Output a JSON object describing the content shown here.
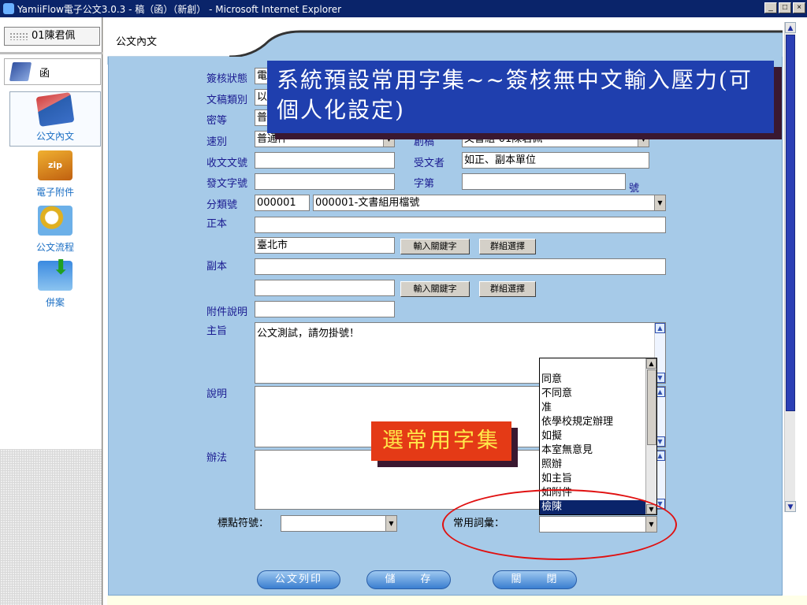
{
  "window": {
    "title": "YamiiFlow電子公文3.0.3 - 稿（函）（新創） - Microsoft Internet Explorer",
    "buttons": [
      "_",
      "□",
      "×"
    ]
  },
  "sidebar": {
    "user": "01陳君佩",
    "header": "函",
    "items": [
      {
        "label": "公文內文",
        "icon": "document-stack-icon",
        "active": true
      },
      {
        "label": "電子附件",
        "icon": "zip-icon",
        "active": false
      },
      {
        "label": "公文流程",
        "icon": "flow-icon",
        "active": false
      },
      {
        "label": "併案",
        "icon": "merge-icon",
        "active": false
      }
    ]
  },
  "main": {
    "tab_title": "公文內文"
  },
  "form": {
    "labels": {
      "sign_status": "簽核狀態",
      "draft_type": "文稿類別",
      "secrecy": "密等",
      "speed": "速別",
      "sender_no": "收文文號",
      "doc_no": "發文字號",
      "category_no": "分類號",
      "main_recipient": "正本",
      "cc": "副本",
      "attachment_desc": "附件說明",
      "subject": "主旨",
      "description": "說明",
      "method": "辦法",
      "unit": "創稿",
      "recipient": "受文者",
      "word_no": "字第",
      "hao": "號",
      "punctuation": "標點符號：",
      "common_phrases": "常用詞彙："
    },
    "values": {
      "sign_status": "電",
      "draft_type": "以",
      "secrecy": "普",
      "speed": "普通件",
      "unit": "文書組-01陳君佩",
      "sender_no": "",
      "doc_no": "",
      "recipient": "如正、副本單位",
      "word_no": "",
      "category_code": "000001",
      "category_name": "000001-文書組用檔號",
      "main_recipient": "",
      "main_recipient_keyword": "臺北市",
      "cc": "",
      "cc_keyword": "",
      "attachment_desc": "",
      "subject": "公文測試，請勿掛號！",
      "description": "",
      "method": "",
      "punctuation": "",
      "common_phrases": ""
    },
    "buttons": {
      "keyword_input": "輸入關鍵字",
      "group_select": "群組選擇"
    },
    "phrase_options": [
      "同意",
      "不同意",
      "准",
      "依學校規定辦理",
      "如擬",
      "本室無意見",
      "照辦",
      "如主旨",
      "如附件",
      "檢陳"
    ],
    "phrase_selected": "檢陳"
  },
  "actions": {
    "print": "公文列印",
    "save": "儲　　存",
    "close": "關　　閉"
  },
  "annotations": {
    "big": "系統預設常用字集~~簽核無中文輸入壓力(可個人化設定)",
    "small": "選常用字集"
  },
  "colors": {
    "panel_bg": "#a6cae8",
    "callout_blue": "#1f3fae",
    "callout_red": "#e43a16",
    "callout_yellow_text": "#ffe94a",
    "ellipse_red": "#e01010",
    "titlebar": "#0a246a"
  }
}
